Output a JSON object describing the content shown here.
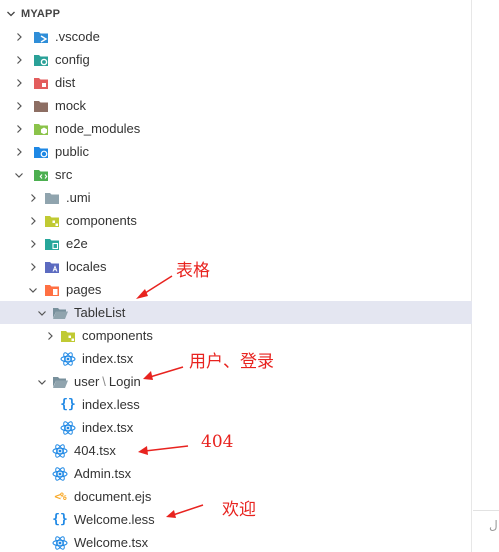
{
  "explorer": {
    "section_title": "MYAPP",
    "rows": [
      {
        "label": ".vscode",
        "icon": "folder-vscode-icon",
        "color": "#2f8ed8"
      },
      {
        "label": "config",
        "icon": "folder-config-icon",
        "color": "#2aa198"
      },
      {
        "label": "dist",
        "icon": "folder-dist-icon",
        "color": "#e35d5d"
      },
      {
        "label": "mock",
        "icon": "folder-mock-icon",
        "color": "#8d6e63"
      },
      {
        "label": "node_modules",
        "icon": "folder-node-icon",
        "color": "#8bc34a"
      },
      {
        "label": "public",
        "icon": "folder-public-icon",
        "color": "#1e88e5"
      },
      {
        "label": "src",
        "icon": "folder-src-icon",
        "color": "#4caf50"
      },
      {
        "label": ".umi",
        "icon": "folder-icon",
        "color": "#90a4ae"
      },
      {
        "label": "components",
        "icon": "folder-components-icon",
        "color": "#c0ca33"
      },
      {
        "label": "e2e",
        "icon": "folder-e2e-icon",
        "color": "#26a69a"
      },
      {
        "label": "locales",
        "icon": "folder-locales-icon",
        "color": "#5c6bc0"
      },
      {
        "label": "pages",
        "icon": "folder-pages-icon",
        "color": "#ff7043"
      },
      {
        "label": "TableList",
        "icon": "folder-open-icon",
        "color": "#90a4ae"
      },
      {
        "label": "components",
        "icon": "folder-components-icon",
        "color": "#c0ca33"
      },
      {
        "label": "index.tsx",
        "icon": "react-icon",
        "color": "#1e88e5"
      },
      {
        "label": "user",
        "label2": "Login",
        "icon": "folder-open-icon",
        "color": "#90a4ae"
      },
      {
        "label": "index.less",
        "icon": "braces-icon",
        "color": "#1e88e5"
      },
      {
        "label": "index.tsx",
        "icon": "react-icon",
        "color": "#1e88e5"
      },
      {
        "label": "404.tsx",
        "icon": "react-icon",
        "color": "#1e88e5"
      },
      {
        "label": "Admin.tsx",
        "icon": "react-icon",
        "color": "#1e88e5"
      },
      {
        "label": "document.ejs",
        "icon": "ejs-icon",
        "color": "#f9a825"
      },
      {
        "label": "Welcome.less",
        "icon": "braces-icon",
        "color": "#1e88e5"
      },
      {
        "label": "Welcome.tsx",
        "icon": "react-icon",
        "color": "#1e88e5"
      }
    ]
  },
  "annotations": {
    "table": "表格",
    "user_login": "用户、登录",
    "notfound": "404",
    "welcome": "欢迎",
    "color": "#e8231f"
  },
  "right_pane": {
    "fragment": "ل"
  }
}
